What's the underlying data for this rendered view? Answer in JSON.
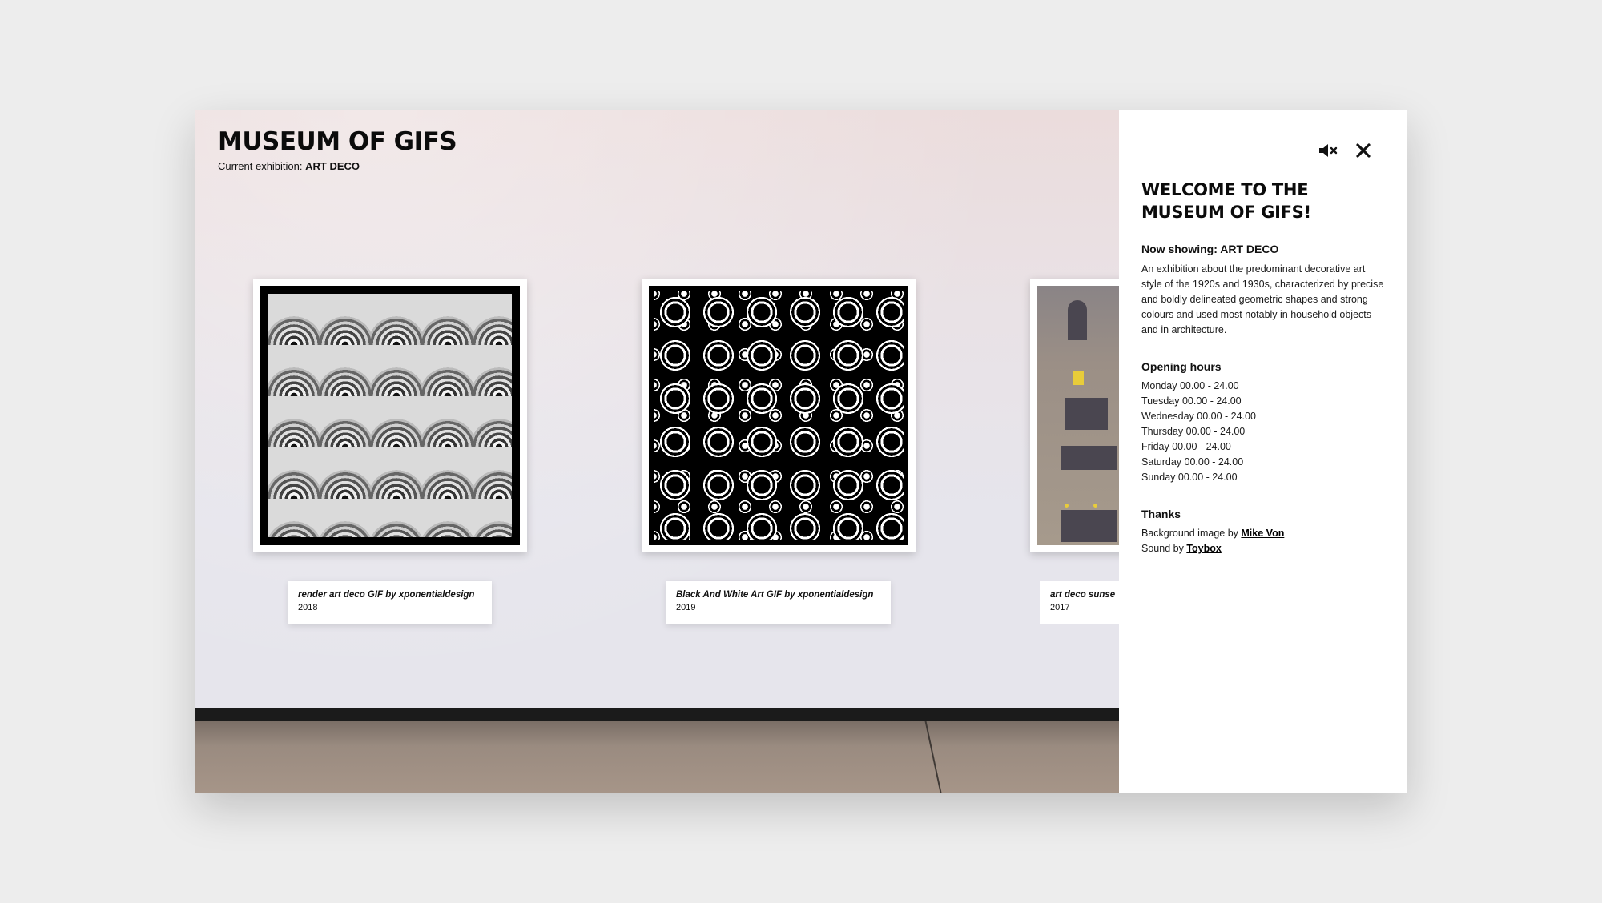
{
  "header": {
    "title": "MUSEUM OF GIFS",
    "exhibition_prefix": "Current exhibition:",
    "exhibition_name": "ART DECO"
  },
  "artworks": [
    {
      "title": "render art deco GIF by xponentialdesign",
      "year": "2018"
    },
    {
      "title": "Black And White Art GIF by xponentialdesign",
      "year": "2019"
    },
    {
      "title": "art deco sunse",
      "year": "2017"
    }
  ],
  "panel": {
    "heading": "WELCOME TO THE MUSEUM OF GIFS!",
    "now_showing": "Now showing: ART DECO",
    "description": "An exhibition about the predominant decorative art style of the 1920s and 1930s, characterized by precise and boldly delineated geometric shapes and strong colours and used most notably in household objects and in architecture.",
    "hours_heading": "Opening hours",
    "hours": [
      "Monday 00.00 - 24.00",
      "Tuesday 00.00 - 24.00",
      "Wednesday 00.00 - 24.00",
      "Thursday 00.00 - 24.00",
      "Friday 00.00 - 24.00",
      "Saturday 00.00 - 24.00",
      "Sunday 00.00 - 24.00"
    ],
    "thanks_heading": "Thanks",
    "credits": [
      {
        "prefix": "Background image by",
        "link": "Mike Von"
      },
      {
        "prefix": "Sound by",
        "link": "Toybox"
      }
    ],
    "icons": {
      "mute": "mute-icon",
      "close": "close-icon"
    }
  }
}
